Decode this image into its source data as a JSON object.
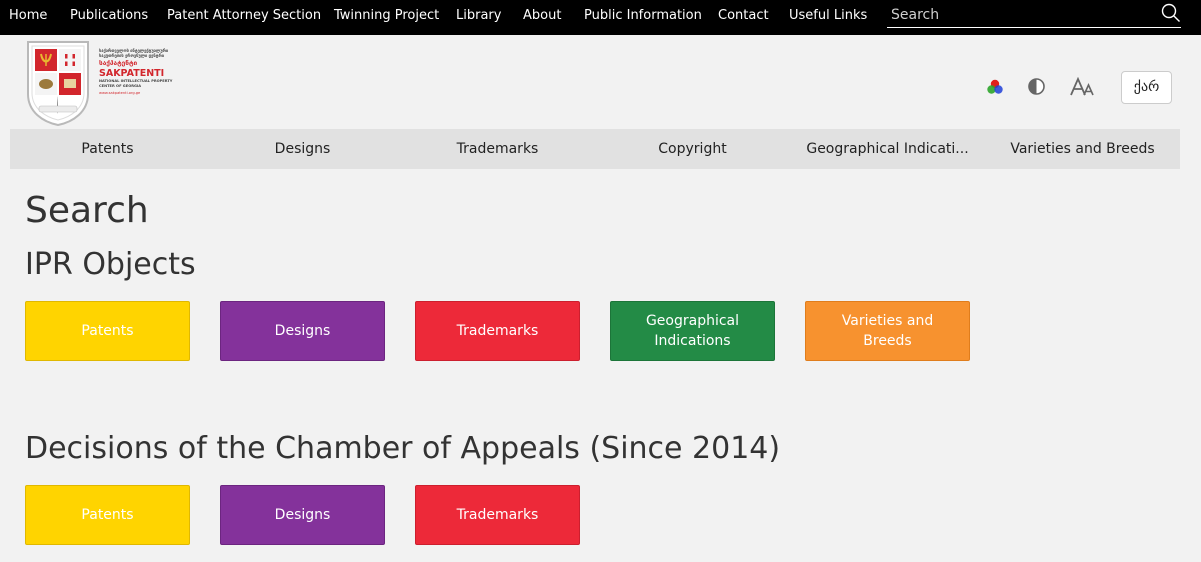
{
  "top_nav": {
    "items": [
      {
        "label": "Home"
      },
      {
        "label": "Publications"
      },
      {
        "label": "Patent Attorney Section"
      },
      {
        "label": "Twinning Project"
      },
      {
        "label": "Library"
      },
      {
        "label": "About"
      },
      {
        "label": "Public Information"
      },
      {
        "label": "Contact"
      },
      {
        "label": "Useful Links"
      }
    ],
    "search_placeholder": "Search",
    "search_icon": "search-icon"
  },
  "logo": {
    "small_lines": [
      "საქართველოს ინტელექტუალური",
      "საკუთრების ეროვნული ცენტრი"
    ],
    "georgian_name": "საქპატენტი",
    "brand": "SAKPATENTI",
    "sub_lines": [
      "NATIONAL INTELLECTUAL PROPERTY",
      "CENTER OF GEORGIA"
    ],
    "url": "www.sakpatenti.org.ge"
  },
  "toolbar": {
    "color_icon": "color-scheme-icon",
    "contrast_icon": "contrast-icon",
    "font_size_icon": "font-size-icon",
    "language_label": "ქარ"
  },
  "category_nav": {
    "items": [
      {
        "label": "Patents"
      },
      {
        "label": "Designs"
      },
      {
        "label": "Trademarks"
      },
      {
        "label": "Copyright"
      },
      {
        "label": "Geographical Indicati..."
      },
      {
        "label": "Varieties and Breeds"
      }
    ]
  },
  "main": {
    "title": "Search",
    "ipr_section": {
      "heading": "IPR Objects",
      "tiles": [
        {
          "label": "Patents",
          "color": "#ffd400"
        },
        {
          "label": "Designs",
          "color": "#84329b"
        },
        {
          "label": "Trademarks",
          "color": "#ed2939"
        },
        {
          "label": "Geographical Indications",
          "color": "#238b46"
        },
        {
          "label": "Varieties and Breeds",
          "color": "#f7922f"
        }
      ]
    },
    "appeals_section": {
      "heading": "Decisions of the Chamber of Appeals (Since 2014)",
      "tiles": [
        {
          "label": "Patents",
          "color": "#ffd400"
        },
        {
          "label": "Designs",
          "color": "#84329b"
        },
        {
          "label": "Trademarks",
          "color": "#ed2939"
        }
      ]
    }
  }
}
